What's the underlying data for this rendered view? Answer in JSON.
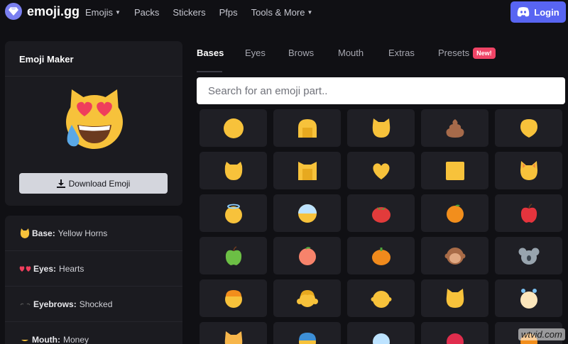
{
  "app": {
    "logo_text": "emoji.gg",
    "logo_icon": "diamond-icon",
    "login_label": "Login",
    "login_icon": "discord-icon",
    "accent_color": "#5865f2"
  },
  "nav": [
    {
      "label": "Emojis",
      "dropdown": true
    },
    {
      "label": "Packs",
      "dropdown": false
    },
    {
      "label": "Stickers",
      "dropdown": false
    },
    {
      "label": "Pfps",
      "dropdown": false
    },
    {
      "label": "Tools & More",
      "dropdown": true
    }
  ],
  "maker": {
    "title": "Emoji Maker",
    "download_label": "Download Emoji",
    "download_icon": "download-icon"
  },
  "parts": [
    {
      "key": "Base:",
      "value": "Yellow Horns",
      "icon": "cat-face-icon"
    },
    {
      "key": "Eyes:",
      "value": "Hearts",
      "icon": "heart-eyes-icon"
    },
    {
      "key": "Eyebrows:",
      "value": "Shocked",
      "icon": "eyebrows-icon"
    },
    {
      "key": "Mouth:",
      "value": "Money",
      "icon": "mouth-icon"
    }
  ],
  "tabs": [
    {
      "label": "Bases",
      "active": true
    },
    {
      "label": "Eyes",
      "active": false
    },
    {
      "label": "Brows",
      "active": false
    },
    {
      "label": "Mouth",
      "active": false
    },
    {
      "label": "Extras",
      "active": false
    },
    {
      "label": "Presets",
      "active": false,
      "badge": "New!"
    }
  ],
  "search": {
    "placeholder": "Search for an emoji part.."
  },
  "grid": [
    [
      "circle-base-icon",
      "round-horned-base-icon",
      "cat-ears-base-icon",
      "poop-base-icon",
      "drop-base-icon"
    ],
    [
      "bear-base-icon",
      "square-ears-base-icon",
      "heart-base-icon",
      "square-base-icon",
      "fox-base-icon"
    ],
    [
      "halo-base-icon",
      "mask-base-icon",
      "tomato-base-icon",
      "orange-base-icon",
      "apple-red-base-icon"
    ],
    [
      "apple-green-base-icon",
      "peach-base-icon",
      "pumpkin-base-icon",
      "monkey-base-icon",
      "koala-base-icon"
    ],
    [
      "beanie-base-icon",
      "pigtails-base-icon",
      "person-base-icon",
      "cat-face-base-icon",
      "bunny-base-icon"
    ],
    [
      "tabby-cat-base-icon",
      "blue-cap-base-icon",
      "light-blue-base-icon",
      "red-base-icon",
      "orange-stripe-base-icon"
    ]
  ],
  "watermark": "wtvid.com"
}
